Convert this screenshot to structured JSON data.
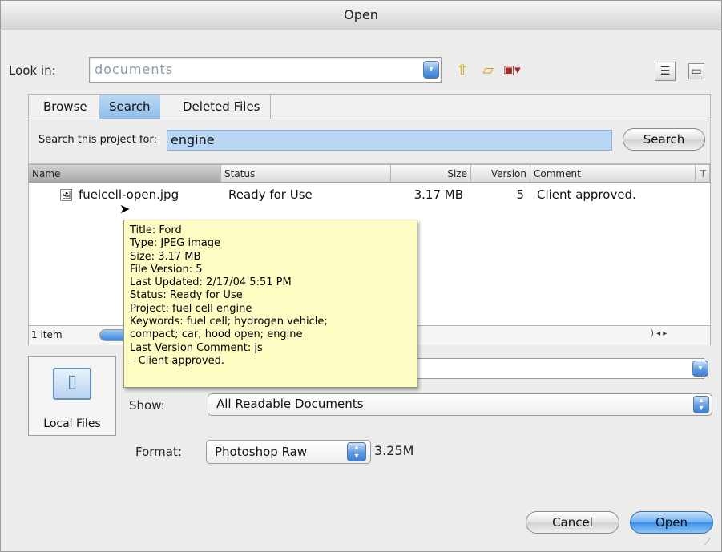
{
  "window": {
    "title": "Open"
  },
  "lookin": {
    "label": "Look in:",
    "value": "documents"
  },
  "tabs": [
    "Browse",
    "Search",
    "Deleted Files"
  ],
  "search": {
    "label": "Search this project for:",
    "query": "engine",
    "button": "Search"
  },
  "columns": [
    "Name",
    "Status",
    "Size",
    "Version",
    "Comment"
  ],
  "rows": [
    {
      "name": "fuelcell-open.jpg",
      "status": "Ready for Use",
      "size": "3.17 MB",
      "version": "5",
      "comment": "Client approved."
    }
  ],
  "item_count": "1 item",
  "tooltip": [
    "Title: Ford",
    "Type: JPEG image",
    "Size: 3.17 MB",
    "File Version: 5",
    "Last Updated: 2/17/04 5:51 PM",
    "Status: Ready for Use",
    "Project: fuel cell engine",
    "Keywords: fuel cell; hydrogen vehicle;",
    "compact; car; hood open; engine",
    "Last Version Comment: js",
    "– Client approved."
  ],
  "local_files": "Local Files",
  "show": {
    "label": "Show:",
    "value": "All Readable Documents"
  },
  "format": {
    "label": "Format:",
    "value": "Photoshop Raw",
    "size": "3.25M"
  },
  "buttons": {
    "cancel": "Cancel",
    "open": "Open"
  },
  "colors": {
    "selection": "#b9d7f5",
    "tooltip_bg": "#fdfcc3",
    "default_button": "#4a95e8"
  }
}
